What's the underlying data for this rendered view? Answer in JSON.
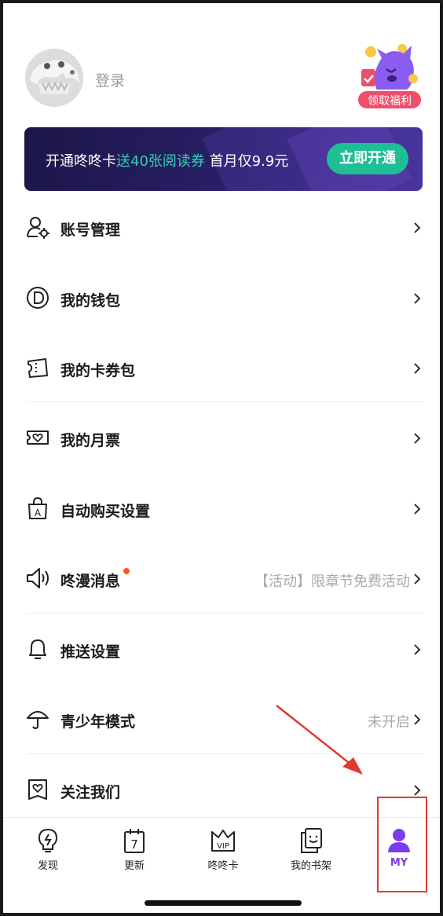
{
  "profile": {
    "login_label": "登录",
    "benefit_label": "领取福利"
  },
  "banner": {
    "text_prefix": "开通咚咚卡",
    "text_highlight": "送40张阅读券",
    "text_suffix": " 首月仅9.9元",
    "button_label": "立即开通",
    "highlight_color": "#35d0b4",
    "button_color": "#1fbf95"
  },
  "menu": {
    "items": [
      {
        "label": "账号管理",
        "icon": "account-settings-icon"
      },
      {
        "label": "我的钱包",
        "icon": "wallet-coin-icon"
      },
      {
        "label": "我的卡券包",
        "icon": "ticket-icon"
      },
      {
        "label": "我的月票",
        "icon": "monthly-ticket-icon"
      },
      {
        "label": "自动购买设置",
        "icon": "shopping-bag-icon"
      },
      {
        "label": "咚漫消息",
        "icon": "speaker-icon",
        "value": "【活动】限章节免费活动",
        "has_dot": true
      },
      {
        "label": "推送设置",
        "icon": "bell-icon"
      },
      {
        "label": "青少年模式",
        "icon": "umbrella-icon",
        "value": "未开启"
      },
      {
        "label": "关注我们",
        "icon": "heart-badge-icon"
      }
    ]
  },
  "tabbar": {
    "tabs": [
      {
        "label": "发现",
        "icon": "lightbulb-icon"
      },
      {
        "label": "更新",
        "icon": "calendar-7-icon"
      },
      {
        "label": "咚咚卡",
        "icon": "vip-crown-icon"
      },
      {
        "label": "我的书架",
        "icon": "bookshelf-icon"
      },
      {
        "label": "MY",
        "icon": "person-icon",
        "active": true
      }
    ],
    "active_color": "#7b3cf0"
  },
  "annotation": {
    "color": "#e03a30"
  }
}
